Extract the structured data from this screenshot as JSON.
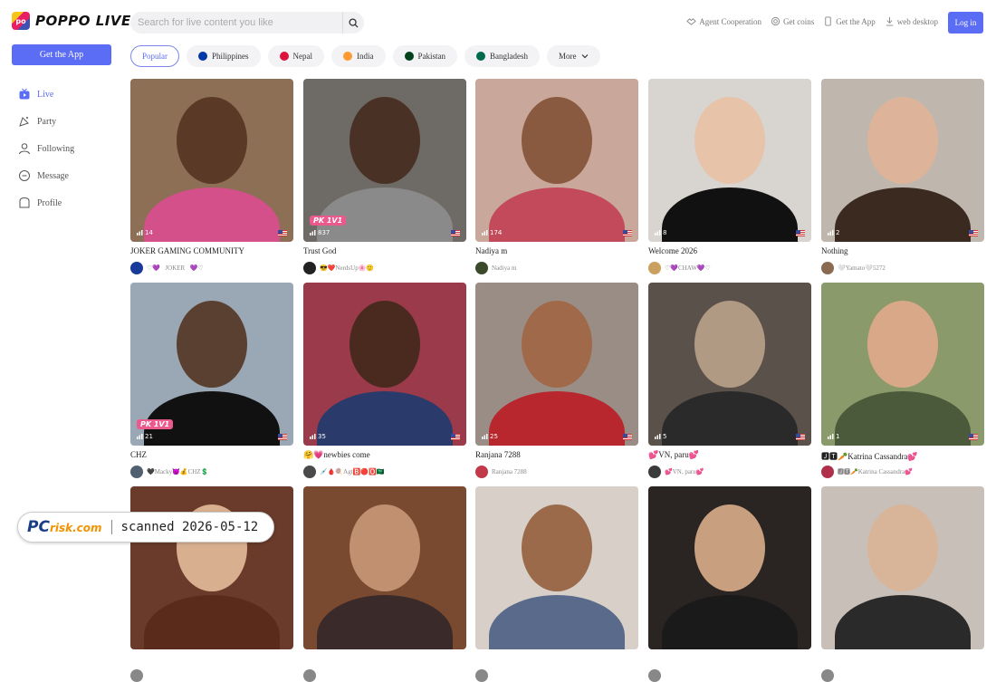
{
  "header": {
    "logo_text": "POPPO LIVE",
    "search_placeholder": "Search for live content you like",
    "links": [
      {
        "label": "Agent Cooperation",
        "icon": "handshake-icon"
      },
      {
        "label": "Get coins",
        "icon": "coin-icon"
      },
      {
        "label": "Get the App",
        "icon": "phone-icon"
      },
      {
        "label": "web desktop",
        "icon": "download-icon"
      }
    ],
    "login_label": "Log in"
  },
  "sidebar": {
    "get_app_label": "Get the App",
    "items": [
      {
        "label": "Live",
        "icon": "tv-icon",
        "active": true
      },
      {
        "label": "Party",
        "icon": "party-icon",
        "active": false
      },
      {
        "label": "Following",
        "icon": "user-icon",
        "active": false
      },
      {
        "label": "Message",
        "icon": "message-icon",
        "active": false
      },
      {
        "label": "Profile",
        "icon": "profile-icon",
        "active": false
      }
    ]
  },
  "filters": [
    {
      "label": "Popular",
      "active": true
    },
    {
      "label": "Philippines",
      "flag": "#0038a8"
    },
    {
      "label": "Nepal",
      "flag": "#dc143c"
    },
    {
      "label": "India",
      "flag": "#ff9933"
    },
    {
      "label": "Pakistan",
      "flag": "#01411c"
    },
    {
      "label": "Bangladesh",
      "flag": "#006a4e"
    },
    {
      "label": "More"
    }
  ],
  "streams": [
    {
      "title": "JOKER GAMING COMMUNITY",
      "viewers": "14",
      "host": "♡💜⃝JOKER⃝💜♡",
      "pk": false,
      "bg": "#8c6f55",
      "skin": "#5a3a26",
      "cloth": "#d4508a",
      "av": "#1a3a9a"
    },
    {
      "title": "Trust God",
      "viewers": "837",
      "host": "😎❤️NerdsUp🌸🙂",
      "pk": true,
      "bg": "#6e6a66",
      "skin": "#4a3125",
      "cloth": "#8a8a8a",
      "av": "#222"
    },
    {
      "title": "Nadiya m",
      "viewers": "174",
      "host": "Nadiya m",
      "pk": false,
      "bg": "#c9a79a",
      "skin": "#8a5a40",
      "cloth": "#c24a5a",
      "av": "#3a4a2a"
    },
    {
      "title": "Welcome 2026",
      "viewers": "8",
      "host": "♡💜CHAW💜♡",
      "pk": false,
      "bg": "#d8d4cf",
      "skin": "#e7c3aa",
      "cloth": "#111111",
      "av": "#c9a060"
    },
    {
      "title": "Nothing",
      "viewers": "2",
      "host": "🤍Yamato🤍5272",
      "pk": false,
      "bg": "#bfb6ae",
      "skin": "#ddb49a",
      "cloth": "#3a2a20",
      "av": "#8a6a50"
    },
    {
      "title": "CHZ",
      "viewers": "21",
      "host": "🖤Macky😈💰CHZ💲",
      "pk": true,
      "bg": "#9aa7b5",
      "skin": "#5a4030",
      "cloth": "#111111",
      "av": "#506070"
    },
    {
      "title": "🤗💗newbies come",
      "viewers": "35",
      "host": "💉🩸🍭Agt🅱️🔴🅾️🇸🇦",
      "pk": false,
      "bg": "#9a3a4a",
      "skin": "#4a2a1e",
      "cloth": "#2a3a6a",
      "av": "#4a4a4a"
    },
    {
      "title": "Ranjana 7288",
      "viewers": "25",
      "host": "Ranjana 7288",
      "pk": false,
      "bg": "#9a8d86",
      "skin": "#a06a4a",
      "cloth": "#b8262e",
      "av": "#c23a4a"
    },
    {
      "title": "💕VN, paru💕",
      "viewers": "5",
      "host": "💕VN, paru💕",
      "pk": false,
      "bg": "#5a524a",
      "skin": "#b09a84",
      "cloth": "#2a2a2a",
      "av": "#3a3a3a"
    },
    {
      "title": "🅹🆃🥕Katrina Cassandra💕",
      "viewers": "1",
      "host": "🅹🆃🥕Katrina Cassandra💕",
      "pk": false,
      "bg": "#8a9a6a",
      "skin": "#d8a888",
      "cloth": "#4a5a3a",
      "av": "#b0304a"
    },
    {
      "title": "",
      "viewers": "",
      "host": "",
      "pk": false,
      "bg": "#6a3a2a",
      "skin": "#d8b090",
      "cloth": "#5a2a1a",
      "av": "#888"
    },
    {
      "title": "",
      "viewers": "",
      "host": "",
      "pk": false,
      "bg": "#7a4a30",
      "skin": "#c09070",
      "cloth": "#3a2a2a",
      "av": "#888"
    },
    {
      "title": "",
      "viewers": "",
      "host": "",
      "pk": false,
      "bg": "#d8d0c8",
      "skin": "#9a6a4a",
      "cloth": "#5a6a8a",
      "av": "#888"
    },
    {
      "title": "",
      "viewers": "",
      "host": "",
      "pk": false,
      "bg": "#2a2422",
      "skin": "#c8a080",
      "cloth": "#1a1a1a",
      "av": "#888"
    },
    {
      "title": "",
      "viewers": "",
      "host": "",
      "pk": false,
      "bg": "#c8c0b8",
      "skin": "#d8b498",
      "cloth": "#2a2a2a",
      "av": "#888"
    }
  ],
  "watermark": {
    "logo_main": "PC",
    "logo_sub": "risk.com",
    "text": "scanned 2026-05-12"
  }
}
